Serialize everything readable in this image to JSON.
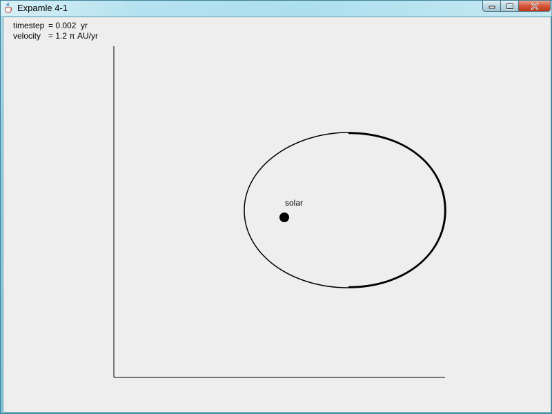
{
  "window": {
    "title": "Expamle 4-1",
    "app_icon": "java-cup-icon",
    "buttons": {
      "minimize": "minimize-icon",
      "maximize": "maximize-icon",
      "close": "close-icon"
    }
  },
  "info": {
    "timestep_label": "timestep",
    "timestep_value": "= 0.002  yr",
    "velocity_label": "velocity",
    "velocity_value": "= 1.2 π AU/yr"
  },
  "plot": {
    "sun_label": "solar",
    "orbit_color": "#000000",
    "sun_color": "#000000",
    "axes_color": "#000000"
  },
  "colors": {
    "client_background": "#eeeeee",
    "frame": "#8fd0e4"
  }
}
